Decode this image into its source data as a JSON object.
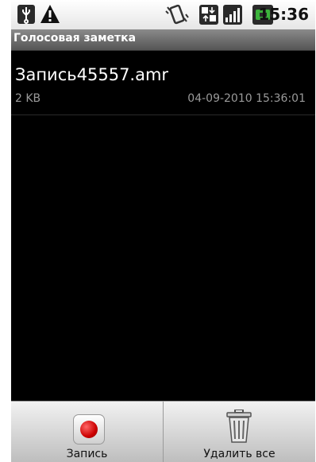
{
  "status_bar": {
    "time": "15:36",
    "icons": [
      "usb-icon",
      "warning-icon",
      "vibrate-icon",
      "data-transfer-icon",
      "signal-icon",
      "battery-icon"
    ]
  },
  "title_bar": {
    "title": "Голосовая заметка"
  },
  "recordings": [
    {
      "name": "Запись45557.amr",
      "size": "2 KB",
      "date": "04-09-2010 15:36:01"
    }
  ],
  "menu": {
    "record_label": "Запись",
    "delete_all_label": "Удалить все"
  },
  "colors": {
    "record_red": "#cc0000",
    "title_bar": "#6e6e6e",
    "background": "#000000"
  }
}
